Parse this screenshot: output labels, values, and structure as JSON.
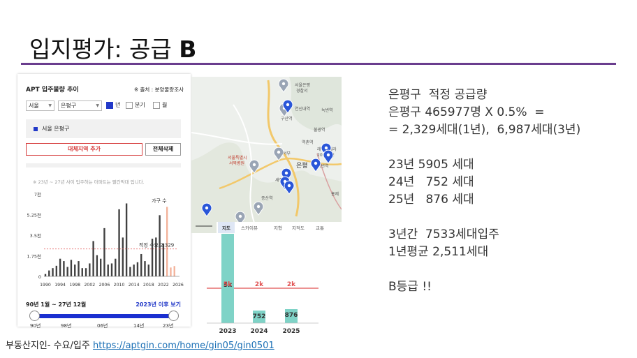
{
  "slide": {
    "title_prefix": "입지평가: 공급 ",
    "title_grade": "B",
    "accent_color": "#6a3d8e"
  },
  "apt_panel": {
    "title": "APT 입주물량 추이",
    "source": "※ 출처 : 분양물량조사",
    "region_select": "서울",
    "district_select": "은평구",
    "period_options": [
      "년",
      "분기",
      "월"
    ],
    "selected_period": "년",
    "legend_item": "서울 은평구",
    "series_color": "#2239c8",
    "add_button": "대체지역 추가",
    "delete_button": "전체삭제",
    "note": "※ 23년 ~ 27년 사이 입주하는 아파트는 빨간막대 입니다.",
    "range_label": "90년 1월 ~ 27년 12월",
    "range_link": "2023년 이후 보기",
    "slider_ticks": [
      "90년",
      "98년",
      "06년",
      "14년",
      "23년"
    ]
  },
  "chart_data": {
    "type": "bar",
    "title": "",
    "series_label": "가구 수",
    "x_ticks": [
      "1990",
      "1994",
      "1998",
      "2002",
      "2006",
      "2010",
      "2014",
      "2018",
      "2022",
      "2026"
    ],
    "y_ticks": [
      "7천",
      "5.25천",
      "3.5천",
      "1.75천",
      "0"
    ],
    "ylim": [
      0,
      7000
    ],
    "reference_label": "적정 수요 2,329",
    "reference_value": 2329,
    "reference_color": "#e05050",
    "future_color": "#ef9a7a",
    "x": [
      1990,
      1991,
      1992,
      1993,
      1994,
      1995,
      1996,
      1997,
      1998,
      1999,
      2000,
      2001,
      2002,
      2003,
      2004,
      2005,
      2006,
      2007,
      2008,
      2009,
      2010,
      2011,
      2012,
      2013,
      2014,
      2015,
      2016,
      2017,
      2018,
      2019,
      2020,
      2021,
      2022,
      2023,
      2024,
      2025,
      2026
    ],
    "values": [
      200,
      500,
      700,
      900,
      1500,
      1300,
      800,
      1400,
      1000,
      1300,
      700,
      700,
      1100,
      3000,
      1800,
      1500,
      4100,
      1000,
      1100,
      1500,
      5700,
      3300,
      6200,
      800,
      1000,
      1200,
      1900,
      1300,
      1000,
      3200,
      3300,
      5200,
      2800,
      5905,
      752,
      876,
      0
    ]
  },
  "map": {
    "tabs": [
      "지도",
      "스카이뷰",
      "지형",
      "지적도",
      "교통"
    ],
    "active_tab": "지도",
    "labels": [
      "서울은평",
      "경찰서",
      "연신내역",
      "녹번역",
      "구산역",
      "불광역",
      "역촌역",
      "서울서부",
      "서울특별시",
      "서북병원",
      "은평",
      "새절역",
      "증산역",
      "래미안베라",
      "2018.12",
      "녹번역",
      "홍제"
    ]
  },
  "bar_chart": {
    "labels": [
      "2023",
      "2024",
      "2025"
    ],
    "values": [
      5905,
      752,
      876
    ],
    "value_labels": [
      "5k",
      "752",
      "876"
    ],
    "ref_labels": [
      "5k",
      "2k",
      "2k"
    ],
    "ref_value_label": "2k",
    "bar_color": "#7fd3c7",
    "ref_color": "#e05050"
  },
  "info": {
    "lines": [
      "은평구  적정 공급량",
      "은평구 465977명 X 0.5%  =",
      "= 2,329세대(1년),  6,987세대(3년)",
      "",
      "23년 5905 세대",
      "24년   752 세대",
      "25년   876 세대",
      "",
      "3년간  7533세대입주",
      "1년평균 2,511세대",
      "",
      "B등급 !!"
    ]
  },
  "footer": {
    "prefix": "부동산지인- 수요/입주 ",
    "link": "https://aptgin.com/home/gin05/gin0501"
  }
}
